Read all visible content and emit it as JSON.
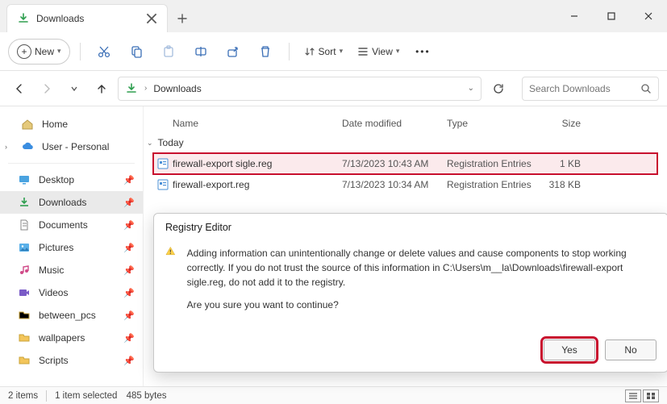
{
  "window": {
    "tab_title": "Downloads",
    "new_label": "New",
    "sort_label": "Sort",
    "view_label": "View"
  },
  "nav": {
    "crumb": "Downloads",
    "search_placeholder": "Search Downloads"
  },
  "sidebar": {
    "home": "Home",
    "user": "User - Personal",
    "quick": [
      "Desktop",
      "Downloads",
      "Documents",
      "Pictures",
      "Music",
      "Videos",
      "between_pcs",
      "wallpapers",
      "Scripts"
    ]
  },
  "columns": {
    "name": "Name",
    "date": "Date modified",
    "type": "Type",
    "size": "Size"
  },
  "group_label": "Today",
  "files": [
    {
      "name": "firewall-export sigle.reg",
      "date": "7/13/2023 10:43 AM",
      "type": "Registration Entries",
      "size": "1 KB",
      "selected": true
    },
    {
      "name": "firewall-export.reg",
      "date": "7/13/2023 10:34 AM",
      "type": "Registration Entries",
      "size": "318 KB",
      "selected": false
    }
  ],
  "dialog": {
    "title": "Registry Editor",
    "line1": "Adding information can unintentionally change or delete values and cause components to stop working correctly. If you do not trust the source of this information in C:\\Users\\m__la\\Downloads\\firewall-export sigle.reg, do not add it to the registry.",
    "line2": "Are you sure you want to continue?",
    "yes": "Yes",
    "no": "No"
  },
  "status": {
    "count": "2 items",
    "selection": "1 item selected",
    "size": "485 bytes"
  }
}
